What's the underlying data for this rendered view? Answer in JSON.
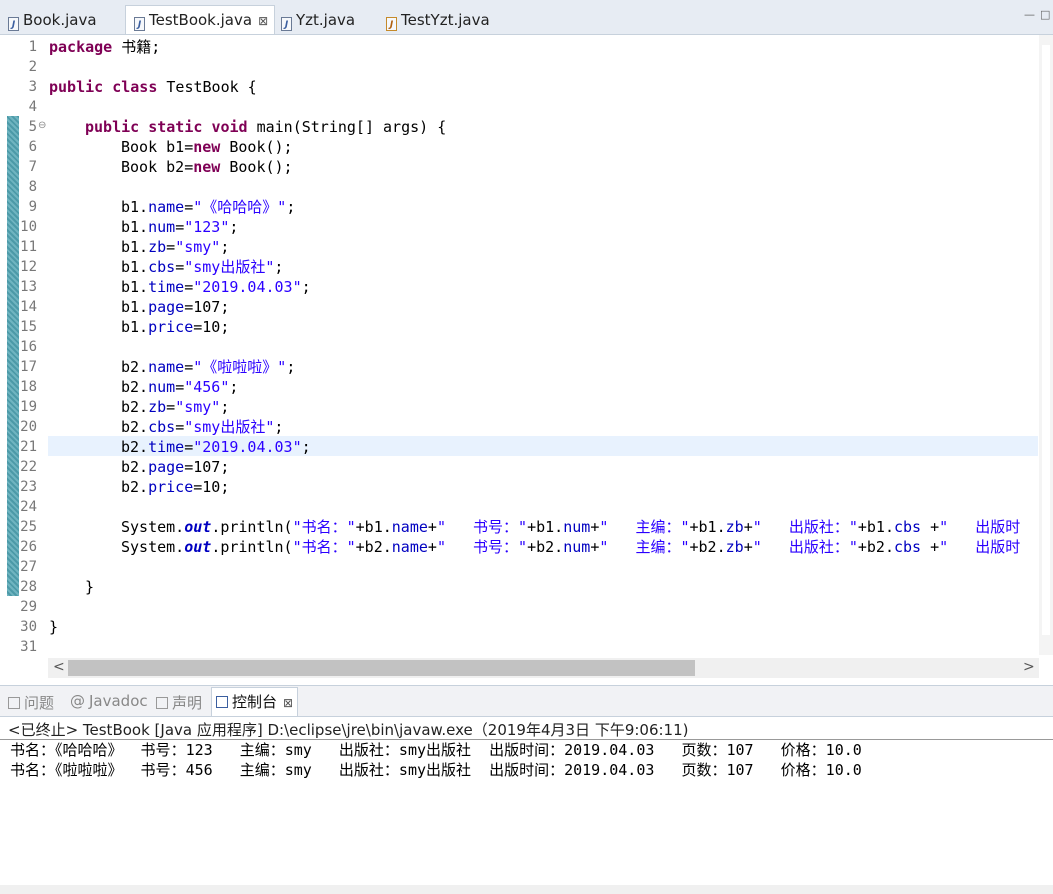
{
  "tabs": [
    {
      "label": "Book.java",
      "active": false,
      "icon": "java-file-icon"
    },
    {
      "label": "TestBook.java",
      "active": true,
      "icon": "java-file-icon",
      "close": "⊠"
    },
    {
      "label": "Yzt.java",
      "active": false,
      "icon": "java-file-icon"
    },
    {
      "label": "TestYzt.java",
      "active": false,
      "icon": "java-run-file-icon"
    }
  ],
  "window_controls": {
    "minimize": "—",
    "maximize": "□"
  },
  "editor": {
    "line_numbers": [
      "1",
      "2",
      "3",
      "4",
      "5",
      "6",
      "7",
      "8",
      "9",
      "10",
      "11",
      "12",
      "13",
      "14",
      "15",
      "16",
      "17",
      "18",
      "19",
      "20",
      "21",
      "22",
      "23",
      "24",
      "25",
      "26",
      "27",
      "28",
      "29",
      "30",
      "31"
    ],
    "fold_marker": "⊖",
    "code": {
      "l1_kw": "package",
      "l1_rest": " 书籍;",
      "l3_kw1": "public",
      "l3_kw2": "class",
      "l3_rest": " TestBook {",
      "l5_kw1": "public",
      "l5_kw2": "static",
      "l5_kw3": "void",
      "l5_rest": " main(String[] args) {",
      "l6_pre": "Book b1=",
      "l6_kw": "new",
      "l6_post": " Book();",
      "l7_pre": "Book b2=",
      "l7_kw": "new",
      "l7_post": " Book();",
      "l9_var": "b1.",
      "l9_fld": "name",
      "l9_eq": "=",
      "l9_str": "\"《哈哈哈》\"",
      "l9_end": ";",
      "l10_var": "b1.",
      "l10_fld": "num",
      "l10_eq": "=",
      "l10_str": "\"123\"",
      "l10_end": ";",
      "l11_var": "b1.",
      "l11_fld": "zb",
      "l11_eq": "=",
      "l11_str": "\"smy\"",
      "l11_end": ";",
      "l12_var": "b1.",
      "l12_fld": "cbs",
      "l12_eq": "=",
      "l12_str": "\"smy出版社\"",
      "l12_end": ";",
      "l13_var": "b1.",
      "l13_fld": "time",
      "l13_eq": "=",
      "l13_str": "\"2019.04.03\"",
      "l13_end": ";",
      "l14_var": "b1.",
      "l14_fld": "page",
      "l14_rest": "=107;",
      "l15_var": "b1.",
      "l15_fld": "price",
      "l15_rest": "=10;",
      "l17_var": "b2.",
      "l17_fld": "name",
      "l17_eq": "=",
      "l17_str": "\"《啦啦啦》\"",
      "l17_end": ";",
      "l18_var": "b2.",
      "l18_fld": "num",
      "l18_eq": "=",
      "l18_str": "\"456\"",
      "l18_end": ";",
      "l19_var": "b2.",
      "l19_fld": "zb",
      "l19_eq": "=",
      "l19_str": "\"smy\"",
      "l19_end": ";",
      "l20_var": "b2.",
      "l20_fld": "cbs",
      "l20_eq": "=",
      "l20_str": "\"smy出版社\"",
      "l20_end": ";",
      "l21_var": "b2.",
      "l21_fld": "time",
      "l21_eq": "=",
      "l21_str": "\"2019.04.03\"",
      "l21_end": ";",
      "l22_var": "b2.",
      "l22_fld": "page",
      "l22_rest": "=107;",
      "l23_var": "b2.",
      "l23_fld": "price",
      "l23_rest": "=10;",
      "l25_a": "System.",
      "l25_out": "out",
      "l25_b": ".println(",
      "l25_s1": "\"书名：\"",
      "l25_c1": "+b1.",
      "l25_f1": "name",
      "l25_c2": "+",
      "l25_s2": "\"   书号：\"",
      "l25_c3": "+b1.",
      "l25_f2": "num",
      "l25_c4": "+",
      "l25_s3": "\"   主编：\"",
      "l25_c5": "+b1.",
      "l25_f3": "zb",
      "l25_c6": "+",
      "l25_s4": "\"   出版社：\"",
      "l25_c7": "+b1.",
      "l25_f4": "cbs",
      "l25_c8": " +",
      "l25_s5": "\"   出版时",
      "l26_a": "System.",
      "l26_out": "out",
      "l26_b": ".println(",
      "l26_s1": "\"书名：\"",
      "l26_c1": "+b2.",
      "l26_f1": "name",
      "l26_c2": "+",
      "l26_s2": "\"   书号：\"",
      "l26_c3": "+b2.",
      "l26_f2": "num",
      "l26_c4": "+",
      "l26_s3": "\"   主编：\"",
      "l26_c5": "+b2.",
      "l26_f3": "zb",
      "l26_c6": "+",
      "l26_s4": "\"   出版社：\"",
      "l26_c7": "+b2.",
      "l26_f4": "cbs",
      "l26_c8": " +",
      "l26_s5": "\"   出版时",
      "l28": "}",
      "l30": "}"
    }
  },
  "scroll": {
    "left_arrow": "<",
    "right_arrow": ">"
  },
  "console_tabs": [
    {
      "label": "问题",
      "icon": "problems-icon"
    },
    {
      "label": "Javadoc",
      "icon": "javadoc-icon"
    },
    {
      "label": "声明",
      "icon": "declaration-icon"
    },
    {
      "label": "控制台",
      "icon": "console-icon",
      "active": true,
      "close": "⊠"
    }
  ],
  "console": {
    "title": "<已终止> TestBook [Java 应用程序] D:\\eclipse\\jre\\bin\\javaw.exe（2019年4月3日 下午9:06:11)",
    "lines": [
      "书名：《哈哈哈》  书号：123   主编：smy   出版社：smy出版社  出版时间：2019.04.03   页数：107   价格：10.0",
      "书名：《啦啦啦》  书号：456   主编：smy   出版社：smy出版社  出版时间：2019.04.03   页数：107   价格：10.0"
    ]
  },
  "colors": {
    "keyword": "#7f0055",
    "string": "#2a00ff",
    "field": "#0000c0",
    "current_line": "#e8f2fe"
  }
}
